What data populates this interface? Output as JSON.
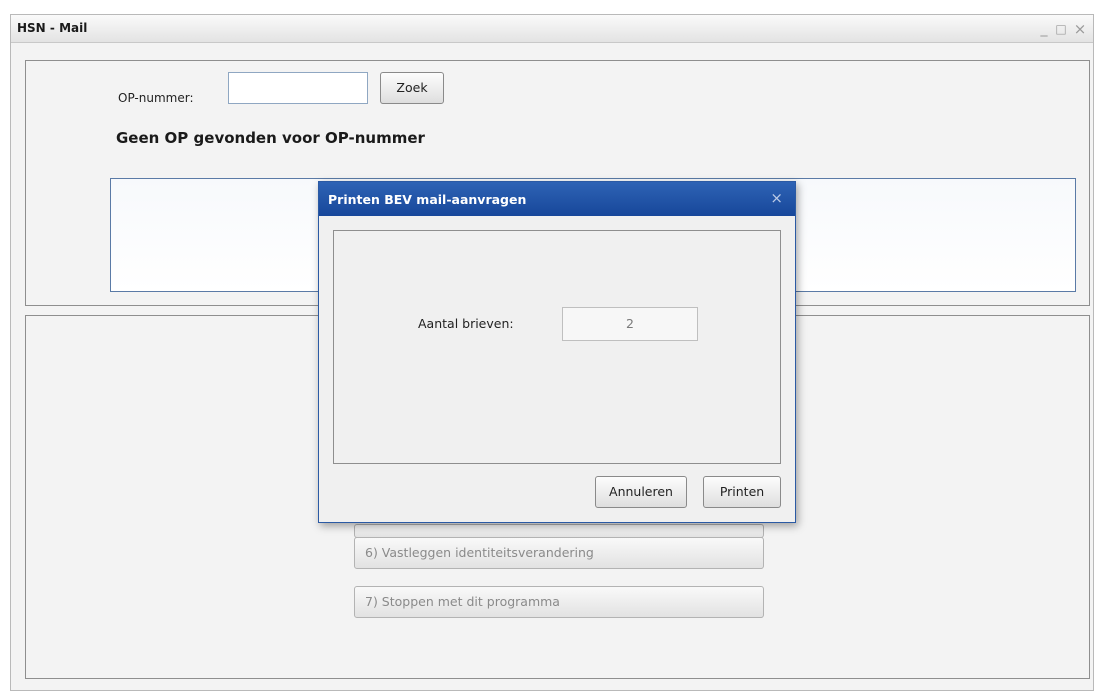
{
  "window": {
    "title": "HSN - Mail",
    "controls": {
      "minimize": "_",
      "maximize": "□",
      "close": "×"
    }
  },
  "search": {
    "label": "OP-nummer:",
    "value": "",
    "button_label": "Zoek"
  },
  "status_message": "Geen OP gevonden voor OP-nummer",
  "menu": {
    "items": [
      {
        "label": "6) Vastleggen identiteitsverandering",
        "enabled": false
      },
      {
        "label": "7) Stoppen met dit programma",
        "enabled": false
      }
    ]
  },
  "dialog": {
    "title": "Printen BEV mail-aanvragen",
    "close_glyph": "×",
    "count_label": "Aantal brieven:",
    "count_value": "2",
    "cancel_label": "Annuleren",
    "print_label": "Printen"
  },
  "colors": {
    "dialog_title_bg": "#1f52a6",
    "field_border": "#8fa7c2",
    "disabled_text": "#8a8a8a"
  }
}
